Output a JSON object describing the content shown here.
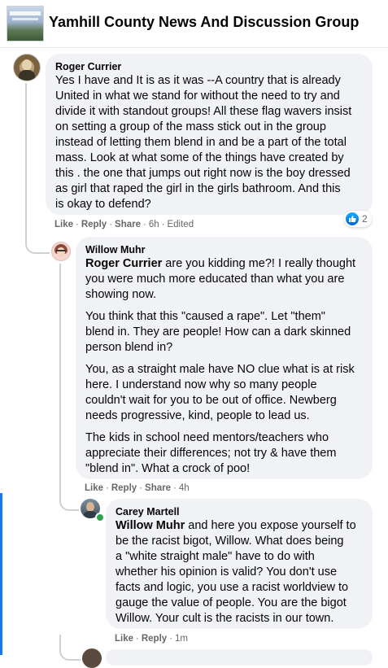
{
  "header": {
    "group_name": "Yamhill County News And Discussion Group"
  },
  "comments": [
    {
      "author": "Roger Currier",
      "lines": [
        "Yes I have and It is as it was --A country that is already",
        "United in what we stand for without the need to try and",
        "divide it with standout groups! All these flag wavers insist",
        "on setting a group of the mass stick out in the group",
        "instead of letting them blend in and be a part of the total",
        "mass. Look at what some of the things have created by",
        "this . the one that jumps out right now is the boy dressed",
        "as girl that raped the girl in the girls bathroom. And this",
        "is okay to defend?"
      ],
      "actions": {
        "like": "Like",
        "reply": "Reply",
        "share": "Share",
        "time": "6h",
        "edited": "Edited"
      },
      "reaction_count": "2"
    },
    {
      "author": "Willow Muhr",
      "mention": "Roger Currier",
      "paragraphs": [
        {
          "first_rest": " are you kidding me?! I really thought",
          "lines": [
            "you were much more educated than what you are",
            "showing now."
          ]
        },
        {
          "lines": [
            "You think that this \"caused a rape\". Let \"them\"",
            "blend in. They are people! How can a dark skinned",
            "person blend in?"
          ]
        },
        {
          "lines": [
            "You, as a straight male have NO clue what is at risk",
            "here. I understand now why so many people",
            "couldn't wait for you to be out of office. Newberg",
            "needs progressive, kind, people to lead us."
          ]
        },
        {
          "lines": [
            "The kids in school need mentors/teachers who",
            "appreciate their differences; not try & have them",
            "\"blend in\". What a crock of poo!"
          ]
        }
      ],
      "actions": {
        "like": "Like",
        "reply": "Reply",
        "share": "Share",
        "time": "4h"
      }
    },
    {
      "author": "Carey Martell",
      "mention": "Willow Muhr",
      "first_rest": " and here you expose yourself to",
      "lines": [
        "be the racist bigot, Willow. What does being",
        "a \"white straight male\" have to do with",
        "whether his opinion is valid? You don't use",
        "facts and logic, you use a racist worldview to",
        "gauge the value of people. You are the bigot",
        "Willow. Your cult is the racists in our town."
      ],
      "actions": {
        "like": "Like",
        "reply": "Reply",
        "time": "1m"
      }
    }
  ],
  "colors": {
    "bubble": "#f0f2f5",
    "meta_text": "#65676b",
    "like_blue": "#1877f2",
    "online": "#31a24c"
  },
  "icons": {
    "reaction": "like-thumb-icon",
    "online": "online-status-dot"
  }
}
